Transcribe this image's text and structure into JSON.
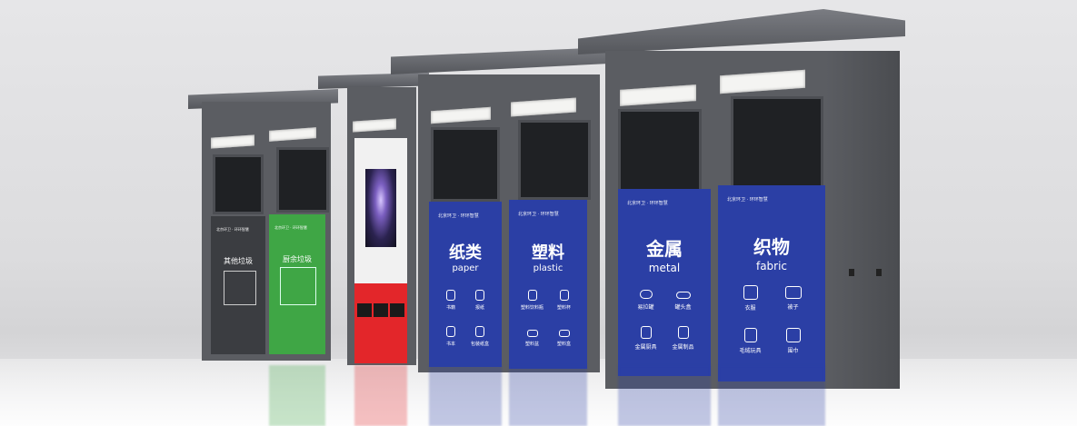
{
  "bins": {
    "other": {
      "cn": "其他垃圾",
      "logo": "北京环卫 · 环环智慧",
      "color": "#3b3d41"
    },
    "kitchen": {
      "cn": "厨余垃圾",
      "logo": "北京环卫 · 环环智慧",
      "color": "#3fa645"
    },
    "paper": {
      "cn": "纸类",
      "en": "paper",
      "logo": "北京环卫 · 环环智慧",
      "color": "#2b3fa5",
      "items": [
        "书籍",
        "报纸",
        "书本",
        "包装纸盒"
      ]
    },
    "plastic": {
      "cn": "塑料",
      "en": "plastic",
      "logo": "北京环卫 · 环环智慧",
      "color": "#2b3fa5",
      "items": [
        "塑料饮料瓶",
        "塑料杯",
        "塑料盆",
        "塑料盒"
      ]
    },
    "metal": {
      "cn": "金属",
      "en": "metal",
      "logo": "北京环卫 · 环环智慧",
      "color": "#2b3fa5",
      "items": [
        "易拉罐",
        "罐头盒",
        "金属厨具",
        "金属制品"
      ]
    },
    "fabric": {
      "cn": "织物",
      "en": "fabric",
      "logo": "北京环卫 · 环环智慧",
      "color": "#2b3fa5",
      "items": [
        "衣服",
        "被子",
        "毛绒玩具",
        "围巾"
      ]
    }
  },
  "kiosk": {
    "red_color": "#e3262a"
  }
}
